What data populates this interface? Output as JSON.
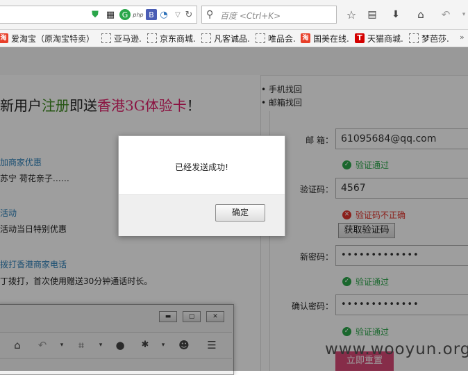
{
  "browser": {
    "search_placeholder": "百度 <Ctrl+K>",
    "bookmarks": [
      {
        "label": "爱淘宝（原淘宝特卖）",
        "favicon": "taobao"
      },
      {
        "label": "亚马逊.",
        "favicon": "dashed"
      },
      {
        "label": "京东商城.",
        "favicon": "dashed"
      },
      {
        "label": "凡客诚品.",
        "favicon": "dashed"
      },
      {
        "label": "唯品会.",
        "favicon": "dashed"
      },
      {
        "label": "国美在线.",
        "favicon": "gome"
      },
      {
        "label": "天猫商城.",
        "favicon": "tmall"
      },
      {
        "label": "梦芭莎.",
        "favicon": "dashed"
      }
    ],
    "tmall_glyph": "T",
    "taobao_glyph": "淘"
  },
  "page": {
    "headline_parts": [
      "新用户",
      "注册",
      "即送",
      "香港3G体验卡",
      "！"
    ],
    "left_items": [
      {
        "title": "加商家优惠",
        "desc": "苏宁  荷花亲子……"
      },
      {
        "title": "活动",
        "desc": "活动当日特别优惠"
      },
      {
        "title": "拨打香港商家电话",
        "desc": "丁拨打，首次使用赠送30分钟通话时长。"
      }
    ],
    "side_links": [
      "手机找回",
      "邮箱找回"
    ],
    "form": {
      "email_label": "邮 箱：",
      "email_value": "61095684@qq.com",
      "email_hint": "验证通过",
      "code_label": "验证码：",
      "code_value": "4567",
      "code_hint": "验证码不正确",
      "get_code_button": "获取验证码",
      "newpw_label": "新密码：",
      "newpw_value": "•••••••••••••",
      "newpw_hint": "验证通过",
      "confirm_label": "确认密码：",
      "confirm_value": "•••••••••••••",
      "confirm_hint": "验证通过",
      "submit_button": "立即重置"
    }
  },
  "dialog": {
    "message": "已经发送成功!",
    "ok_button": "确定"
  },
  "watermark": "www.wooyun.org"
}
